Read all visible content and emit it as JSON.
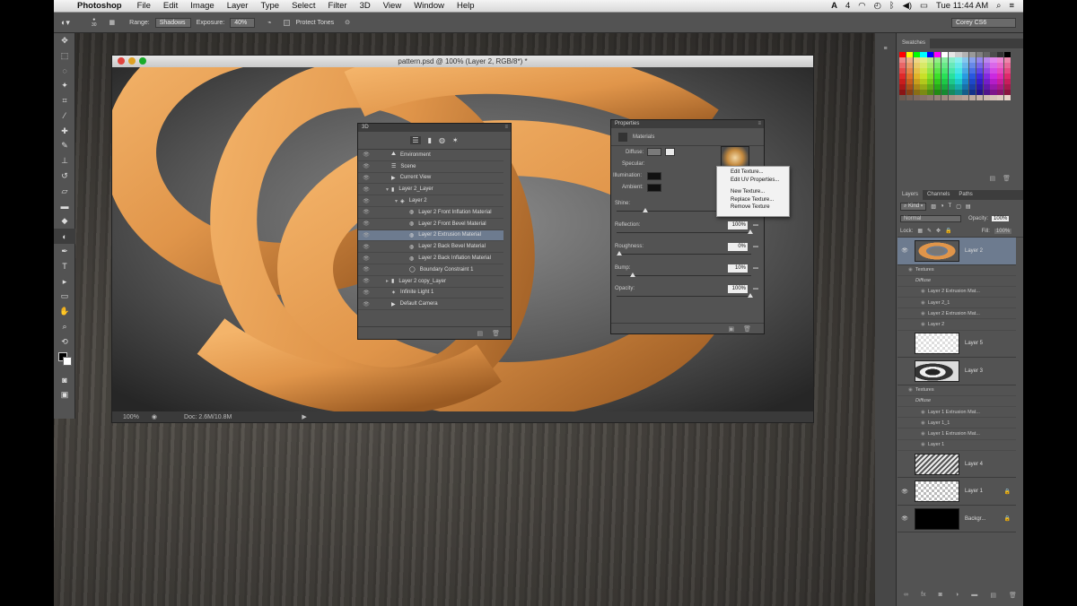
{
  "menubar": {
    "app_name": "Photoshop",
    "menus": [
      "File",
      "Edit",
      "Image",
      "Layer",
      "Type",
      "Select",
      "Filter",
      "3D",
      "View",
      "Window",
      "Help"
    ],
    "status_badge": "4",
    "clock": "Tue 11:44 AM",
    "icons": [
      "apple-icon",
      "adobe-icon",
      "wifi-icon",
      "time-machine-icon",
      "bluetooth-icon",
      "volume-icon",
      "battery-icon",
      "spotlight-icon",
      "list-icon"
    ]
  },
  "options_bar": {
    "brush_size": "30",
    "range_label": "Range:",
    "range_value": "Shadows",
    "exposure_label": "Exposure:",
    "exposure_value": "40%",
    "protect_tones_label": "Protect Tones",
    "workspace": "Corey CS6"
  },
  "document": {
    "title": "pattern.psd @ 100% (Layer 2, RGB/8*) *",
    "zoom": "100%",
    "doc_size": "Doc: 2.6M/10.8M"
  },
  "panel_3d": {
    "title": "3D",
    "rows": [
      {
        "label": "Environment",
        "indent": 1,
        "icon": "environment-icon"
      },
      {
        "label": "Scene",
        "indent": 1,
        "icon": "scene-icon"
      },
      {
        "label": "Current View",
        "indent": 1,
        "icon": "camera-icon"
      },
      {
        "label": "Layer 2_Layer",
        "indent": 1,
        "icon": "layer-mesh-icon",
        "expanded": true
      },
      {
        "label": "Layer 2",
        "indent": 2,
        "icon": "mesh-icon",
        "expanded": true
      },
      {
        "label": "Layer 2 Front Inflation Material",
        "indent": 3,
        "icon": "material-icon"
      },
      {
        "label": "Layer 2 Front Bevel Material",
        "indent": 3,
        "icon": "material-icon"
      },
      {
        "label": "Layer 2 Extrusion Material",
        "indent": 3,
        "icon": "material-icon",
        "selected": true
      },
      {
        "label": "Layer 2 Back Bevel Material",
        "indent": 3,
        "icon": "material-icon"
      },
      {
        "label": "Layer 2 Back Inflation Material",
        "indent": 3,
        "icon": "material-icon"
      },
      {
        "label": "Boundary Constraint 1",
        "indent": 3,
        "icon": "constraint-icon"
      },
      {
        "label": "Layer 2 copy_Layer",
        "indent": 1,
        "icon": "layer-mesh-icon",
        "collapsed": true
      },
      {
        "label": "Infinite Light 1",
        "indent": 1,
        "icon": "light-icon"
      },
      {
        "label": "Default Camera",
        "indent": 1,
        "icon": "camera-icon"
      }
    ]
  },
  "properties_panel": {
    "title": "Properties",
    "section": "Materials",
    "labels": [
      "Diffuse:",
      "Specular:",
      "Illumination:",
      "Ambient:"
    ],
    "sliders": [
      {
        "label": "Shine:",
        "value": "20%",
        "level": 0.2
      },
      {
        "label": "Reflection:",
        "value": "100%",
        "level": 1.0
      },
      {
        "label": "Roughness:",
        "value": "0%",
        "level": 0.0
      },
      {
        "label": "Bump:",
        "value": "10%",
        "level": 0.1
      },
      {
        "label": "Opacity:",
        "value": "100%",
        "level": 1.0
      }
    ]
  },
  "context_menu": {
    "items": [
      "Edit Texture...",
      "Edit UV Properties...",
      "New Texture...",
      "Replace Texture...",
      "Remove Texture"
    ]
  },
  "swatches_panel": {
    "tab": "Swatches"
  },
  "layers_panel": {
    "tabs": [
      "Layers",
      "Channels",
      "Paths"
    ],
    "filter_kind": "Kind",
    "blend_mode": "Normal",
    "opacity_label": "Opacity:",
    "opacity_value": "100%",
    "lock_label": "Lock:",
    "fill_label": "Fill:",
    "fill_value": "100%",
    "layers": [
      {
        "name": "Layer 2",
        "visible": true,
        "selected": true,
        "thumb": "rings",
        "sub": [
          {
            "label": "Textures"
          },
          {
            "label": "Diffuse",
            "italic": true
          },
          {
            "label": "Layer 2 Extrusion Mat..."
          },
          {
            "label": "Layer 2_1"
          },
          {
            "label": "Layer 2 Extrusion Mat..."
          },
          {
            "label": "Layer 2"
          }
        ]
      },
      {
        "name": "Layer 5",
        "visible": false,
        "thumb": "transparent"
      },
      {
        "name": "Layer 3",
        "visible": false,
        "thumb": "swirl",
        "sub": [
          {
            "label": "Textures"
          },
          {
            "label": "Diffuse",
            "italic": true
          },
          {
            "label": "Layer 1 Extrusion Mat..."
          },
          {
            "label": "Layer 1_1"
          },
          {
            "label": "Layer 1 Extrusion Mat..."
          },
          {
            "label": "Layer 1"
          }
        ]
      },
      {
        "name": "Layer 4",
        "visible": false,
        "thumb": "lines"
      },
      {
        "name": "Layer 1",
        "visible": true,
        "thumb": "checker"
      },
      {
        "name": "Backgr...",
        "visible": true,
        "thumb": "black"
      }
    ]
  },
  "colors": {
    "orange": "#e0954a",
    "selected_row": "#6d7b8f",
    "panel_bg": "#535353"
  }
}
